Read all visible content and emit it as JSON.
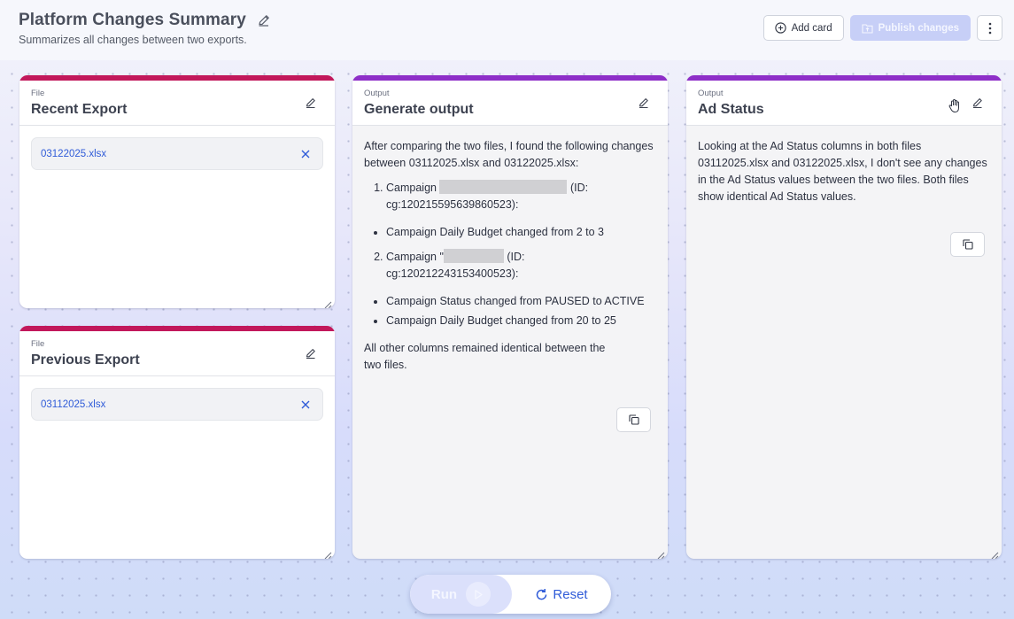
{
  "header": {
    "title": "Platform Changes Summary",
    "subtitle": "Summarizes all changes between two exports.",
    "add_card_label": "Add card",
    "publish_label": "Publish changes"
  },
  "cards": {
    "recent": {
      "kind": "File",
      "title": "Recent Export",
      "file": "03122025.xlsx"
    },
    "previous": {
      "kind": "File",
      "title": "Previous Export",
      "file": "03112025.xlsx"
    },
    "generate": {
      "kind": "Output",
      "title": "Generate output",
      "intro": "After comparing the two files, I found the following changes between 03112025.xlsx and 03122025.xlsx:",
      "item1_prefix": "Campaign",
      "item1_suffix": "(ID: cg:120215595639860523):",
      "item1_bullet": "Campaign Daily Budget changed from 2 to 3",
      "item2_prefix": "Campaign \"",
      "item2_suffix": "(ID: cg:120212243153400523):",
      "item2_bullet1": "Campaign Status changed from PAUSED to ACTIVE",
      "item2_bullet2": "Campaign Daily Budget changed from 20 to 25",
      "outro": "All other columns remained identical between the two files."
    },
    "adstatus": {
      "kind": "Output",
      "title": "Ad Status",
      "text": "Looking at the Ad Status columns in both files 03112025.xlsx and 03122025.xlsx, I don't see any changes in the Ad Status values between the two files. Both files show identical Ad Status values."
    }
  },
  "footer": {
    "run_label": "Run",
    "reset_label": "Reset"
  },
  "colors": {
    "file_accent": "#c2185b",
    "output_accent": "#8e2fc8",
    "link": "#2f5bd8",
    "primary_disabled": "#c7cff7"
  },
  "icons": [
    "pencil-icon",
    "plus-circle-icon",
    "folder-upload-icon",
    "more-vertical-icon",
    "close-icon",
    "copy-icon",
    "hand-icon",
    "resize-handle-icon",
    "play-icon",
    "reset-icon"
  ]
}
